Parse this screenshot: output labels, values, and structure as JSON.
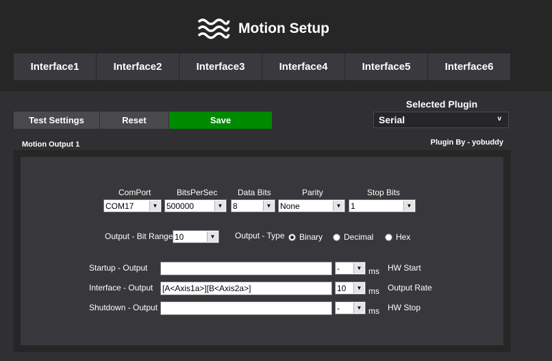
{
  "header": {
    "title": "Motion Setup",
    "icon": "waves-icon"
  },
  "tabs": [
    "Interface1",
    "Interface2",
    "Interface3",
    "Interface4",
    "Interface5",
    "Interface6"
  ],
  "toolbar": {
    "test_settings": "Test Settings",
    "reset": "Reset",
    "save": "Save"
  },
  "plugin": {
    "label": "Selected Plugin",
    "value": "Serial",
    "chevron": "v",
    "by": "Plugin By - yobuddy"
  },
  "section": {
    "title": "Motion Output 1"
  },
  "serial": {
    "labels": {
      "comport": "ComPort",
      "bitspersec": "BitsPerSec",
      "databits": "Data Bits",
      "parity": "Parity",
      "stopbits": "Stop Bits"
    },
    "values": {
      "comport": "COM17",
      "bitspersec": "500000",
      "databits": "8",
      "parity": "None",
      "stopbits": "1"
    }
  },
  "output": {
    "bit_range_label": "Output - Bit Range",
    "bit_range_value": "10",
    "type_label": "Output - Type",
    "types": [
      "Binary",
      "Decimal",
      "Hex"
    ],
    "selected_type": "Binary"
  },
  "commands": {
    "startup_label": "Startup - Output",
    "startup_value": "",
    "startup_ms": "-",
    "startup_ms_unit": "ms",
    "startup_note": "HW Start",
    "interface_label": "Interface - Output",
    "interface_value": "[A<Axis1a>][B<Axis2a>]",
    "interface_ms": "10",
    "interface_ms_unit": "ms",
    "interface_note": "Output Rate",
    "shutdown_label": "Shutdown - Output",
    "shutdown_value": "",
    "shutdown_ms": "-",
    "shutdown_ms_unit": "ms",
    "shutdown_note": "HW Stop"
  },
  "colors": {
    "background": "#303033",
    "header": "#262626",
    "tab": "#3a3a3e",
    "save": "#008a00",
    "panel": "#38383c"
  }
}
